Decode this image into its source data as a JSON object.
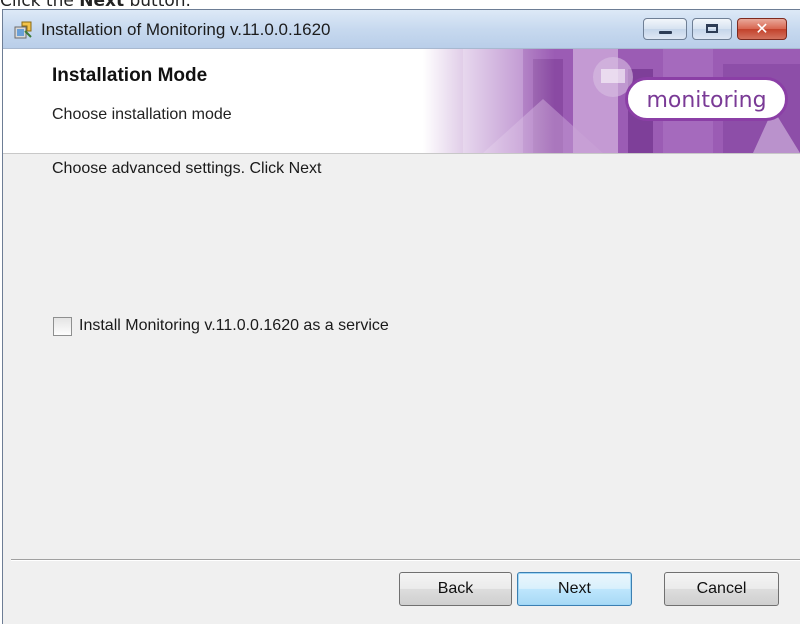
{
  "caption": {
    "prefix": "Click the ",
    "bold": "Next",
    "suffix": " button."
  },
  "window": {
    "title": "Installation of Monitoring v.11.0.0.1620",
    "icon": "installer-icon",
    "controls": {
      "minimize": "minimize-icon",
      "maximize": "maximize-icon",
      "close": "close-icon",
      "close_glyph": "✕"
    }
  },
  "banner": {
    "title": "Installation Mode",
    "subtitle": "Choose installation mode",
    "logo_text": "monitoring",
    "accent_color": "#8b3fa6"
  },
  "content": {
    "instruction": "Choose advanced settings. Click Next",
    "service_checkbox": {
      "label": "Install Monitoring v.11.0.0.1620 as a service",
      "checked": false
    }
  },
  "buttons": {
    "back": "Back",
    "next": "Next",
    "cancel": "Cancel"
  }
}
